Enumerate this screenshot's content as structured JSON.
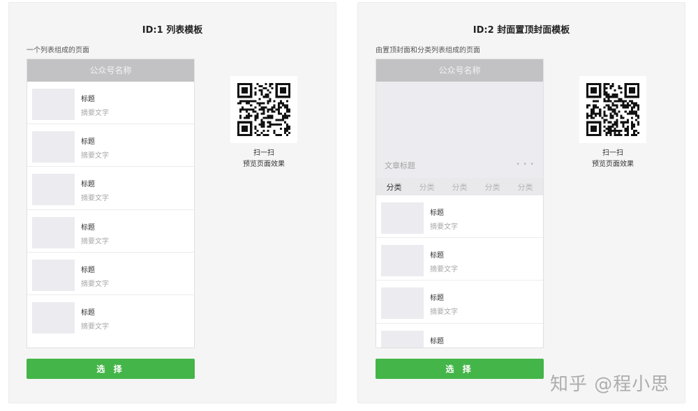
{
  "templates": [
    {
      "title": "ID:1 列表模板",
      "description": "一个列表组成的页面",
      "account_name": "公众号名称",
      "items": [
        {
          "title": "标题",
          "summary": "摘要文字"
        },
        {
          "title": "标题",
          "summary": "摘要文字"
        },
        {
          "title": "标题",
          "summary": "摘要文字"
        },
        {
          "title": "标题",
          "summary": "摘要文字"
        },
        {
          "title": "标题",
          "summary": "摘要文字"
        },
        {
          "title": "标题",
          "summary": "摘要文字"
        }
      ],
      "qr_line1": "扫一扫",
      "qr_line2": "预览页面效果",
      "select_label": "选 择"
    },
    {
      "title": "ID:2 封面置顶封面模板",
      "description": "由置顶封面和分类列表组成的页面",
      "account_name": "公众号名称",
      "cover_title": "文章标题",
      "cover_dots": "• • •",
      "categories": [
        "分类",
        "分类",
        "分类",
        "分类",
        "分类"
      ],
      "active_category": 0,
      "items": [
        {
          "title": "标题",
          "summary": "摘要文字"
        },
        {
          "title": "标题",
          "summary": "摘要文字"
        },
        {
          "title": "标题",
          "summary": "摘要文字"
        },
        {
          "title": "标题",
          "summary": ""
        }
      ],
      "qr_line1": "扫一扫",
      "qr_line2": "预览页面效果",
      "select_label": "选 择"
    }
  ],
  "watermark": "知乎 @程小思",
  "colors": {
    "accent": "#44b549",
    "header": "#c2c2c4",
    "card_bg": "#f5f5f5"
  }
}
